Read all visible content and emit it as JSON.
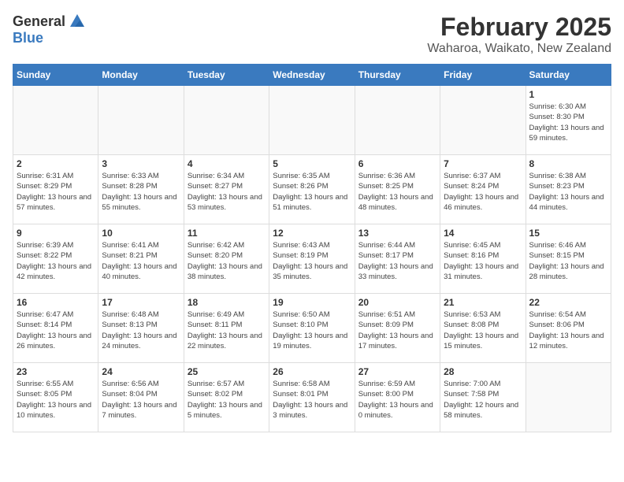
{
  "logo": {
    "general": "General",
    "blue": "Blue"
  },
  "title": "February 2025",
  "subtitle": "Waharoa, Waikato, New Zealand",
  "days_of_week": [
    "Sunday",
    "Monday",
    "Tuesday",
    "Wednesday",
    "Thursday",
    "Friday",
    "Saturday"
  ],
  "weeks": [
    [
      {
        "day": "",
        "info": ""
      },
      {
        "day": "",
        "info": ""
      },
      {
        "day": "",
        "info": ""
      },
      {
        "day": "",
        "info": ""
      },
      {
        "day": "",
        "info": ""
      },
      {
        "day": "",
        "info": ""
      },
      {
        "day": "1",
        "info": "Sunrise: 6:30 AM\nSunset: 8:30 PM\nDaylight: 13 hours and 59 minutes."
      }
    ],
    [
      {
        "day": "2",
        "info": "Sunrise: 6:31 AM\nSunset: 8:29 PM\nDaylight: 13 hours and 57 minutes."
      },
      {
        "day": "3",
        "info": "Sunrise: 6:33 AM\nSunset: 8:28 PM\nDaylight: 13 hours and 55 minutes."
      },
      {
        "day": "4",
        "info": "Sunrise: 6:34 AM\nSunset: 8:27 PM\nDaylight: 13 hours and 53 minutes."
      },
      {
        "day": "5",
        "info": "Sunrise: 6:35 AM\nSunset: 8:26 PM\nDaylight: 13 hours and 51 minutes."
      },
      {
        "day": "6",
        "info": "Sunrise: 6:36 AM\nSunset: 8:25 PM\nDaylight: 13 hours and 48 minutes."
      },
      {
        "day": "7",
        "info": "Sunrise: 6:37 AM\nSunset: 8:24 PM\nDaylight: 13 hours and 46 minutes."
      },
      {
        "day": "8",
        "info": "Sunrise: 6:38 AM\nSunset: 8:23 PM\nDaylight: 13 hours and 44 minutes."
      }
    ],
    [
      {
        "day": "9",
        "info": "Sunrise: 6:39 AM\nSunset: 8:22 PM\nDaylight: 13 hours and 42 minutes."
      },
      {
        "day": "10",
        "info": "Sunrise: 6:41 AM\nSunset: 8:21 PM\nDaylight: 13 hours and 40 minutes."
      },
      {
        "day": "11",
        "info": "Sunrise: 6:42 AM\nSunset: 8:20 PM\nDaylight: 13 hours and 38 minutes."
      },
      {
        "day": "12",
        "info": "Sunrise: 6:43 AM\nSunset: 8:19 PM\nDaylight: 13 hours and 35 minutes."
      },
      {
        "day": "13",
        "info": "Sunrise: 6:44 AM\nSunset: 8:17 PM\nDaylight: 13 hours and 33 minutes."
      },
      {
        "day": "14",
        "info": "Sunrise: 6:45 AM\nSunset: 8:16 PM\nDaylight: 13 hours and 31 minutes."
      },
      {
        "day": "15",
        "info": "Sunrise: 6:46 AM\nSunset: 8:15 PM\nDaylight: 13 hours and 28 minutes."
      }
    ],
    [
      {
        "day": "16",
        "info": "Sunrise: 6:47 AM\nSunset: 8:14 PM\nDaylight: 13 hours and 26 minutes."
      },
      {
        "day": "17",
        "info": "Sunrise: 6:48 AM\nSunset: 8:13 PM\nDaylight: 13 hours and 24 minutes."
      },
      {
        "day": "18",
        "info": "Sunrise: 6:49 AM\nSunset: 8:11 PM\nDaylight: 13 hours and 22 minutes."
      },
      {
        "day": "19",
        "info": "Sunrise: 6:50 AM\nSunset: 8:10 PM\nDaylight: 13 hours and 19 minutes."
      },
      {
        "day": "20",
        "info": "Sunrise: 6:51 AM\nSunset: 8:09 PM\nDaylight: 13 hours and 17 minutes."
      },
      {
        "day": "21",
        "info": "Sunrise: 6:53 AM\nSunset: 8:08 PM\nDaylight: 13 hours and 15 minutes."
      },
      {
        "day": "22",
        "info": "Sunrise: 6:54 AM\nSunset: 8:06 PM\nDaylight: 13 hours and 12 minutes."
      }
    ],
    [
      {
        "day": "23",
        "info": "Sunrise: 6:55 AM\nSunset: 8:05 PM\nDaylight: 13 hours and 10 minutes."
      },
      {
        "day": "24",
        "info": "Sunrise: 6:56 AM\nSunset: 8:04 PM\nDaylight: 13 hours and 7 minutes."
      },
      {
        "day": "25",
        "info": "Sunrise: 6:57 AM\nSunset: 8:02 PM\nDaylight: 13 hours and 5 minutes."
      },
      {
        "day": "26",
        "info": "Sunrise: 6:58 AM\nSunset: 8:01 PM\nDaylight: 13 hours and 3 minutes."
      },
      {
        "day": "27",
        "info": "Sunrise: 6:59 AM\nSunset: 8:00 PM\nDaylight: 13 hours and 0 minutes."
      },
      {
        "day": "28",
        "info": "Sunrise: 7:00 AM\nSunset: 7:58 PM\nDaylight: 12 hours and 58 minutes."
      },
      {
        "day": "",
        "info": ""
      }
    ]
  ]
}
